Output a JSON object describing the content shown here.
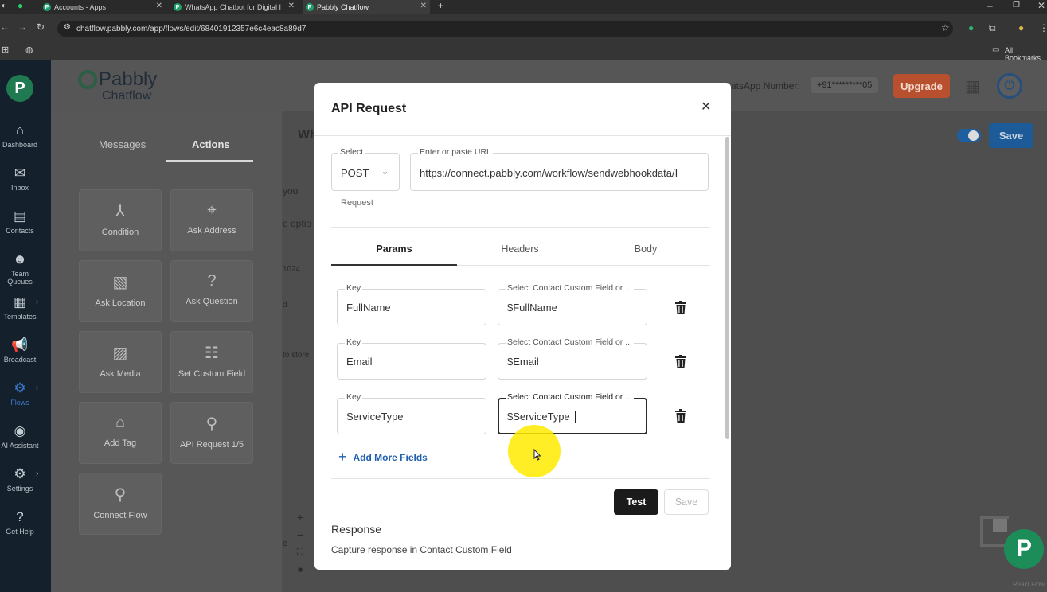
{
  "browser": {
    "tabs": [
      {
        "title": "Accounts - Apps"
      },
      {
        "title": "WhatsApp Chatbot for Digital I"
      },
      {
        "title": "Pabbly Chatflow"
      }
    ],
    "url": "chatflow.pabbly.com/app/flows/edit/68401912357e6c4eac8a89d7",
    "bookmarks_label": "All Bookmarks"
  },
  "app": {
    "logo_line1": "Pabbly",
    "logo_line2": "Chatflow",
    "whatsapp_label": "WhatsApp Number:",
    "whatsapp_number": "+91*********05",
    "upgrade_label": "Upgrade",
    "save_label": "Save",
    "canvas_title_fragment": "Wh",
    "canvas_snippets": [
      "you",
      "e optio",
      "1024",
      "d",
      "to store",
      "e"
    ],
    "footer_credit": "React Flow"
  },
  "sidebar": {
    "items": [
      {
        "label": "Dashboard",
        "icon": "home-icon"
      },
      {
        "label": "Inbox",
        "icon": "inbox-icon"
      },
      {
        "label": "Contacts",
        "icon": "contacts-icon"
      },
      {
        "label": "Team Queues",
        "icon": "team-icon"
      },
      {
        "label": "Templates",
        "icon": "templates-icon"
      },
      {
        "label": "Broadcast",
        "icon": "broadcast-icon"
      },
      {
        "label": "Flows",
        "icon": "flows-icon"
      },
      {
        "label": "AI Assistant",
        "icon": "ai-icon"
      },
      {
        "label": "Settings",
        "icon": "settings-icon"
      },
      {
        "label": "Get Help",
        "icon": "help-icon"
      }
    ]
  },
  "panel": {
    "tabs": [
      "Messages",
      "Actions"
    ],
    "cards": [
      {
        "label": "Condition",
        "icon": "condition-icon"
      },
      {
        "label": "Ask Address",
        "icon": "address-icon"
      },
      {
        "label": "Ask Location",
        "icon": "location-icon"
      },
      {
        "label": "Ask Question",
        "icon": "question-icon"
      },
      {
        "label": "Ask Media",
        "icon": "media-icon"
      },
      {
        "label": "Set Custom Field",
        "icon": "custom-field-icon"
      },
      {
        "label": "Add Tag",
        "icon": "tag-icon"
      },
      {
        "label": "API Request 1/5",
        "icon": "api-icon"
      },
      {
        "label": "Connect Flow",
        "icon": "connect-icon"
      }
    ]
  },
  "modal": {
    "title": "API Request",
    "method_label": "Select",
    "method_value": "POST",
    "url_label": "Enter or paste URL",
    "url_value": "https://connect.pabbly.com/workflow/sendwebhookdata/I",
    "request_label": "Request",
    "tabs": [
      "Params",
      "Headers",
      "Body"
    ],
    "params": [
      {
        "key_label": "Key",
        "key": "FullName",
        "value_label": "Select Contact Custom Field or ...",
        "value": "$FullName"
      },
      {
        "key_label": "Key",
        "key": "Email",
        "value_label": "Select Contact Custom Field or ...",
        "value": "$Email"
      },
      {
        "key_label": "Key",
        "key": "ServiceType",
        "value_label": "Select Contact Custom Field or ...",
        "value": "$ServiceType"
      }
    ],
    "add_fields_label": "Add More Fields",
    "test_label": "Test",
    "save_label": "Save",
    "response_title": "Response",
    "response_sub": "Capture response in Contact Custom Field"
  },
  "colors": {
    "upgrade": "#c4532f",
    "primary": "#1f6fbf",
    "flows_active": "#3d7bd5",
    "add_fields": "#1f5fae"
  }
}
